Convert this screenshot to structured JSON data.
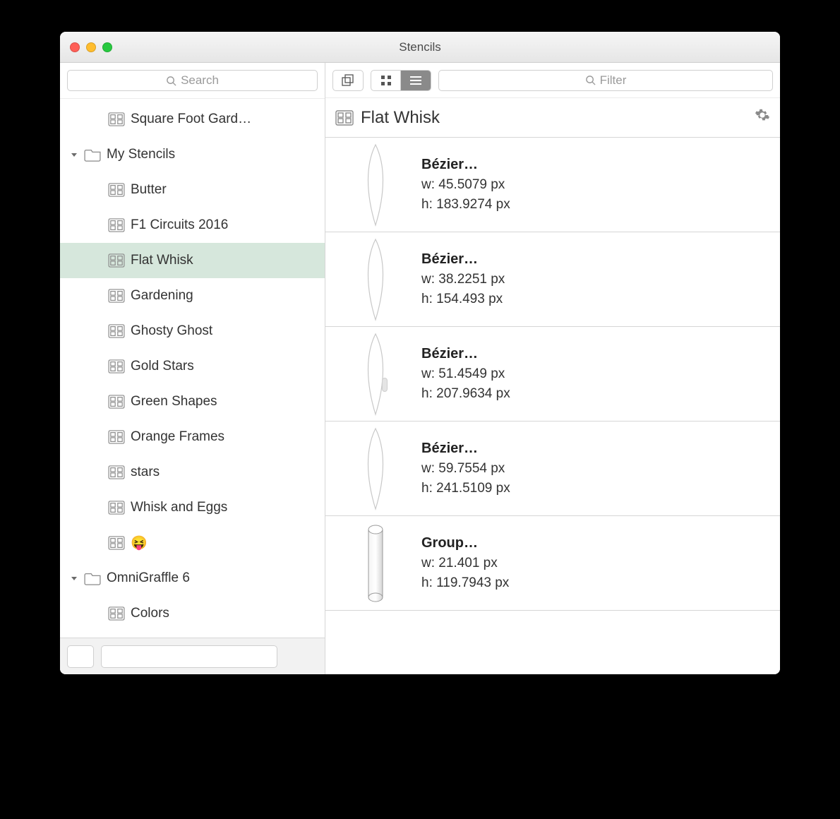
{
  "window": {
    "title": "Stencils"
  },
  "sidebar": {
    "search_placeholder": "Search",
    "rows": [
      {
        "type": "leaf",
        "label": "Square Foot Gard…",
        "selected": false
      },
      {
        "type": "folder",
        "label": "My Stencils",
        "expanded": true
      },
      {
        "type": "leaf",
        "label": "Butter",
        "selected": false
      },
      {
        "type": "leaf",
        "label": "F1 Circuits 2016",
        "selected": false
      },
      {
        "type": "leaf",
        "label": "Flat Whisk",
        "selected": true
      },
      {
        "type": "leaf",
        "label": "Gardening",
        "selected": false
      },
      {
        "type": "leaf",
        "label": "Ghosty Ghost",
        "selected": false
      },
      {
        "type": "leaf",
        "label": "Gold Stars",
        "selected": false
      },
      {
        "type": "leaf",
        "label": "Green Shapes",
        "selected": false
      },
      {
        "type": "leaf",
        "label": "Orange Frames",
        "selected": false
      },
      {
        "type": "leaf",
        "label": "stars",
        "selected": false
      },
      {
        "type": "leaf",
        "label": "Whisk and Eggs",
        "selected": false
      },
      {
        "type": "leaf",
        "label": "😝",
        "selected": false
      },
      {
        "type": "folder",
        "label": "OmniGraffle 6",
        "expanded": true
      },
      {
        "type": "leaf",
        "label": "Colors",
        "selected": false
      }
    ]
  },
  "main": {
    "filter_placeholder": "Filter",
    "view_mode": "list",
    "header": {
      "title": "Flat Whisk"
    },
    "items": [
      {
        "name": "Bézier…",
        "w": "45.5079 px",
        "h": "183.9274 px",
        "shape": "whisk"
      },
      {
        "name": "Bézier…",
        "w": "38.2251 px",
        "h": "154.493 px",
        "shape": "whisk"
      },
      {
        "name": "Bézier…",
        "w": "51.4549 px",
        "h": "207.9634 px",
        "shape": "whisk"
      },
      {
        "name": "Bézier…",
        "w": "59.7554 px",
        "h": "241.5109 px",
        "shape": "whisk"
      },
      {
        "name": "Group…",
        "w": "21.401 px",
        "h": "119.7943 px",
        "shape": "cylinder"
      }
    ]
  }
}
